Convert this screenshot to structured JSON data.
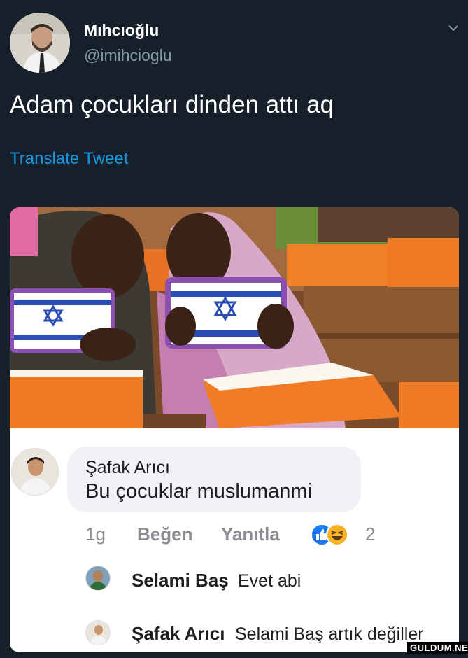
{
  "tweet": {
    "display_name": "Mıhcıoğlu",
    "handle": "@imihcioglu",
    "text": "Adam çocukları dinden attı aq",
    "translate_label": "Translate Tweet"
  },
  "facebook_comment": {
    "author": "Şafak Arıcı",
    "text": "Bu çocuklar muslumanmi",
    "time": "1g",
    "like_label": "Beğen",
    "reply_label": "Yanıtla",
    "reaction_count": "2",
    "replies": [
      {
        "author": "Selami Baş",
        "text": "Evet abi"
      },
      {
        "author": "Şafak Arıcı",
        "text": "Selami Baş  artık değiller"
      }
    ]
  },
  "watermark": "GULDUM.NET",
  "colors": {
    "background": "#15202b",
    "link": "#1b95e0",
    "muted": "#8899a6",
    "like_blue": "#1877f2",
    "haha_yellow": "#f7b125"
  },
  "icons": [
    "chevron-down-icon",
    "like-reaction-icon",
    "haha-reaction-icon",
    "star-of-david-icon"
  ]
}
